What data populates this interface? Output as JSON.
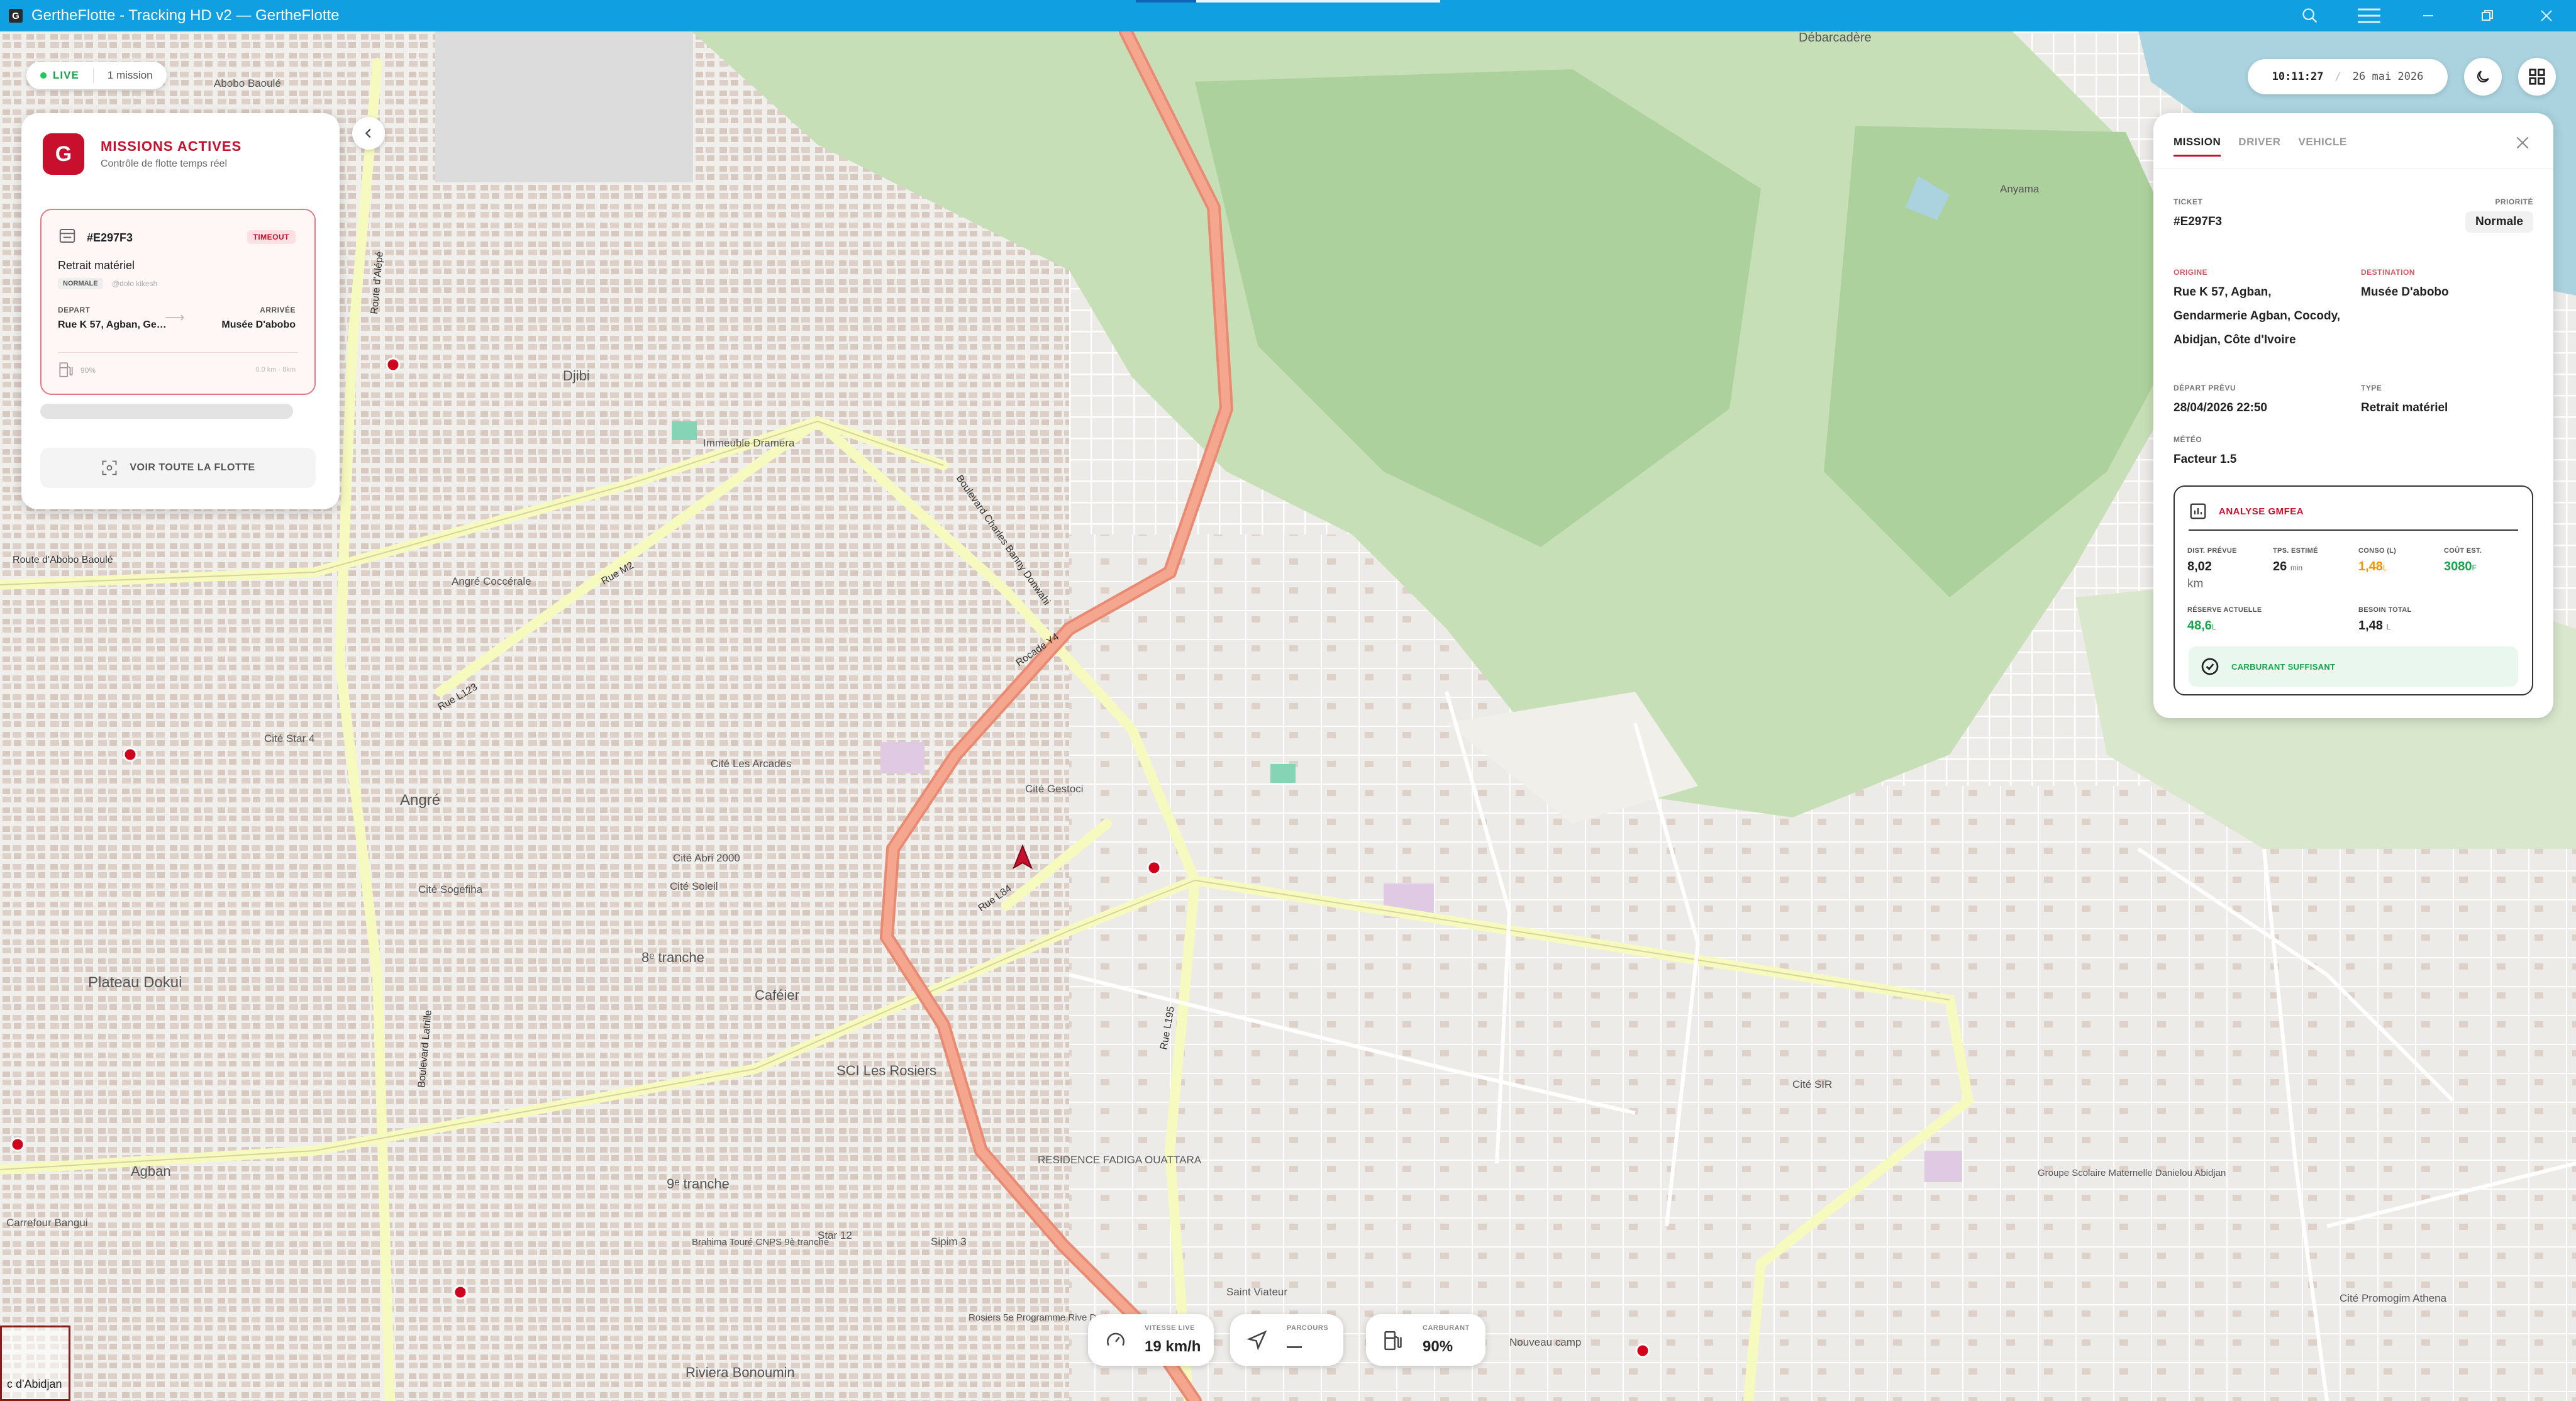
{
  "window": {
    "title": "GertheFlotte - Tracking HD v2 — GertheFlotte",
    "logo": "G"
  },
  "livebar": {
    "status": "LIVE",
    "count": "1 mission"
  },
  "left_panel": {
    "logo": "G",
    "title": "MISSIONS ACTIVES",
    "subtitle": "Contrôle de flotte temps réel",
    "mission": {
      "id": "#E297F3",
      "badge": "TIMEOUT",
      "type": "Retrait matériel",
      "priority": "NORMALE",
      "driver": "@dolo kikesh",
      "departure_label": "DEPART",
      "departure": "Rue K 57, Agban, Gendarmerie Agban, Cocody, Abidjan, Côte d'Ivoire",
      "arrival_label": "ARRIVÉE",
      "arrival": "Musée D'abobo",
      "fuel": "90%",
      "distance": "0.0 km · 8km"
    },
    "fleet_button": "VOIR TOUTE LA FLOTTE"
  },
  "clock": {
    "time": "10:11:27",
    "date": "26 mai 2026"
  },
  "right_panel": {
    "tabs": [
      "MISSION",
      "DRIVER",
      "VEHICLE"
    ],
    "ticket_label": "TICKET",
    "ticket": "#E297F3",
    "priority_label": "PRIORITÉ",
    "priority": "Normale",
    "origin_label": "ORIGINE",
    "origin_lines": [
      "Rue K 57, Agban,",
      "Gendarmerie Agban, Cocody,",
      "Abidjan, Côte d'Ivoire"
    ],
    "destination_label": "DESTINATION",
    "destination": "Musée D'abobo",
    "planned_label": "DÉPART PRÉVU",
    "planned": "28/04/2026 22:50",
    "type_label": "TYPE",
    "type": "Retrait matériel",
    "weather_label": "MÉTÉO",
    "weather": "Facteur 1.5",
    "analysis": {
      "title": "ANALYSE GMFEA",
      "dist_label": "DIST. PRÉVUE",
      "dist": "8,02",
      "dist_unit": "km",
      "time_label": "TPS. ESTIMÉ",
      "time": "26",
      "time_unit": "min",
      "conso_label": "CONSO (L)",
      "conso": "1,48",
      "conso_unit": "L",
      "cost_label": "COÛT EST.",
      "cost": "3080",
      "cost_unit": "F",
      "reserve_label": "RÉSERVE ACTUELLE",
      "reserve": "48,6",
      "reserve_unit": "L",
      "need_label": "BESOIN TOTAL",
      "need": "1,48",
      "need_unit": "L",
      "status": "CARBURANT SUFFISANT"
    }
  },
  "stats": {
    "speed_label": "VITESSE LIVE",
    "speed": "19 km/h",
    "route_label": "PARCOURS",
    "route": "—",
    "fuel_label": "CARBURANT",
    "fuel": "90%"
  },
  "map": {
    "labels": {
      "debarcadere": "Débarcadère",
      "abobo": "Abobo Baoulé",
      "djibi": "Djibi",
      "immeuble": "Immeuble Dramera",
      "angre_cocc": "Angré Coccérale",
      "angre": "Angré",
      "cite_arcades": "Cité Les Arcades",
      "cite_gestoci": "Cité Gestoci",
      "cite_soleil": "Cité Soleil",
      "sogefiha": "Cité Sogefiha",
      "plateau_dokui": "Plateau Dokui",
      "cite_abri": "Cité Abri 2000",
      "cafeier": "Caféier",
      "sci_rosiers": "SCI Les Rosiers",
      "residence": "RESIDENCE FADIGA OUATTARA",
      "riviera": "Riviera Bonoumin",
      "tranche9": "9ᵉ tranche",
      "tranche8": "8ᵉ tranche",
      "agban": "Agban",
      "boulevard_latrille": "Boulevard Latrille",
      "route_abobo": "Route d'Abobo Baoulé",
      "route_alepe": "Route d'Alépé",
      "anyama": "Anyama",
      "cite_sir": "Cité SIR",
      "groupe_scolaire": "Groupe Scolaire Maternelle Danielou Abidjan",
      "cite_promogim": "Cité Promogim Athena",
      "nouveau_camp": "Nouveau camp",
      "saint_viateur": "Saint Viateur",
      "carrefour_bangui": "Carrefour Bangui",
      "rue_l84": "Rue L84",
      "rocade_y4": "Rocade Y4",
      "rue_m2": "Rue M2",
      "rue_l123": "Rue L123",
      "bd_charles": "Boulevard Charles Banny Donwahi",
      "rue_l195": "Rue L195",
      "cite_star": "Cité Star 4",
      "sipim": "Sipim 3",
      "star12": "Star 12",
      "brahima": "Brahima Touré CNPS 9è tranche",
      "rosiers_rd": "Rosiers 5e Programme Rive Droite"
    },
    "attribution": "c d'Abidjan"
  }
}
